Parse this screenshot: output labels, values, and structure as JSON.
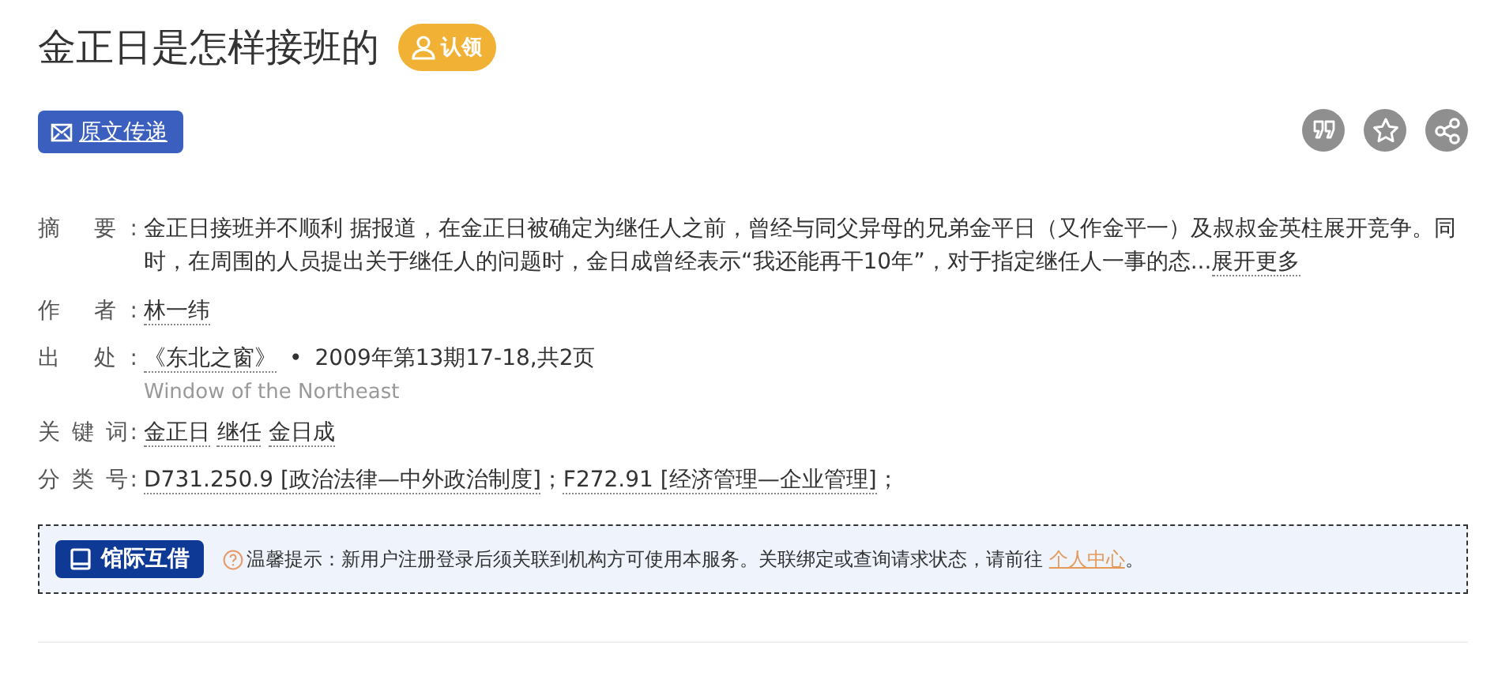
{
  "title": "金正日是怎样接班的",
  "claim_button": {
    "label": "认领"
  },
  "delivery_button": {
    "label": "原文传递"
  },
  "actions": [
    {
      "kind": "cite"
    },
    {
      "kind": "favorite"
    },
    {
      "kind": "share"
    }
  ],
  "fields": [
    {
      "kind": "abstract",
      "label": "摘 要:",
      "text": "金正日接班并不顺利 据报道，在金正日被确定为继任人之前，曾经与同父异母的兄弟金平日（又作金平一）及叔叔金英柱展开竞争。同时，在周围的人员提出关于继任人的问题时，金日成曾经表示“我还能再干10年”，对于指定继任人一事的态...",
      "more": "展开更多"
    },
    {
      "kind": "links",
      "label": "作 者:",
      "links": [
        "林一纬"
      ]
    },
    {
      "kind": "source",
      "label": "出 处:",
      "journal": "《东北之窗》",
      "separator": "•",
      "detail": "2009年第13期17-18,共2页",
      "english": "Window of the Northeast"
    },
    {
      "kind": "links",
      "label": "关 键 词:",
      "links": [
        "金正日",
        "继任",
        "金日成"
      ]
    },
    {
      "kind": "classes",
      "label": "分 类 号:",
      "items": [
        {
          "code": "D731.250.9",
          "name": "[政治法律—中外政治制度]",
          "separator": "；"
        },
        {
          "code": "F272.91",
          "name": "[经济管理—企业管理]",
          "separator": "；"
        }
      ]
    }
  ],
  "notice": {
    "button": "馆际互借",
    "text": "温馨提示：新用户注册登录后须关联到机构方可使用本服务。关联绑定或查询请求状态，请前往",
    "link": "个人中心",
    "end": "。"
  }
}
